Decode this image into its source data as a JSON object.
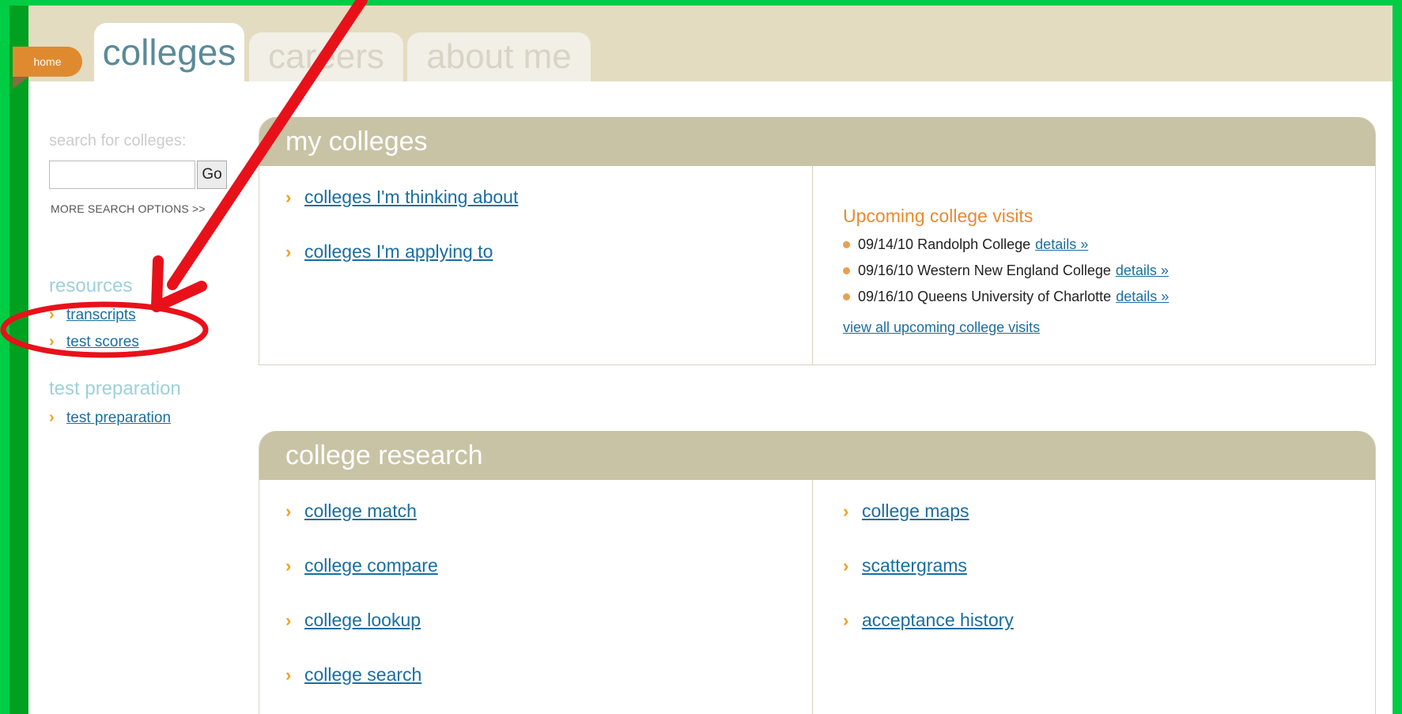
{
  "nav": {
    "home": "home",
    "tabs": [
      {
        "label": "colleges",
        "active": true
      },
      {
        "label": "careers",
        "active": false
      },
      {
        "label": "about me",
        "active": false
      }
    ]
  },
  "sidebar": {
    "search_label": "search for colleges:",
    "search_value": "",
    "go_label": "Go",
    "more_options": "MORE SEARCH OPTIONS >>",
    "resources_heading": "resources",
    "resources": [
      "transcripts",
      "test scores"
    ],
    "test_prep_heading": "test preparation",
    "test_prep": [
      "test preparation"
    ]
  },
  "my_colleges": {
    "title": "my colleges",
    "links": [
      "colleges I'm thinking about",
      "colleges I'm applying to"
    ],
    "visits_title": "Upcoming college visits",
    "visits": [
      {
        "text": "09/14/10 Randolph College",
        "link": "details »"
      },
      {
        "text": "09/16/10 Western New England College",
        "link": "details »"
      },
      {
        "text": "09/16/10 Queens University of Charlotte",
        "link": "details »"
      }
    ],
    "view_all": "view all upcoming college visits"
  },
  "college_research": {
    "title": "college research",
    "left_links": [
      "college match",
      "college compare",
      "college lookup",
      "college search"
    ],
    "right_links": [
      "college maps",
      "scattergrams",
      "acceptance history"
    ]
  },
  "colors": {
    "annotation": "#e8111a",
    "accent": "#f0a020",
    "link": "#1a6ea0",
    "panel_header": "#c8c3a5"
  }
}
